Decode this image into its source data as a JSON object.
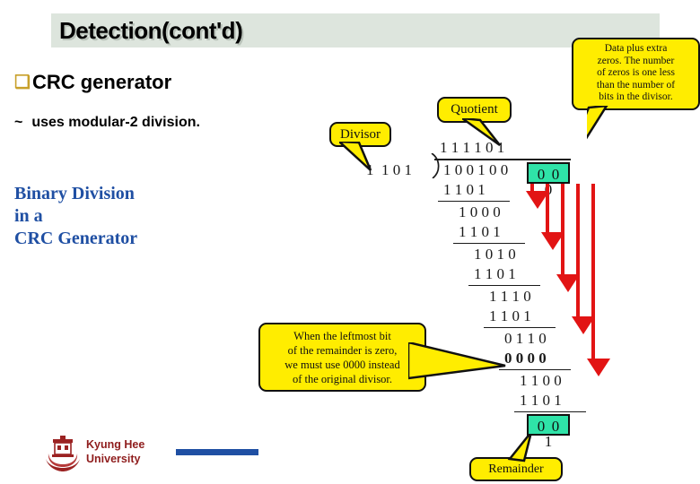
{
  "slide": {
    "title": "Detection(cont'd)",
    "bullets": [
      {
        "marker": "❑",
        "text": "CRC generator"
      },
      {
        "marker": "~",
        "text": "uses modular-2 division."
      }
    ],
    "blue_heading": "Binary Division\nin a\nCRC Generator"
  },
  "footer": {
    "logo_icon": "university-crest-icon",
    "organization": "Kyung Hee\nUniversity"
  },
  "callouts": [
    {
      "id": "divisor",
      "text": "Divisor"
    },
    {
      "id": "quotient",
      "text": "Quotient"
    },
    {
      "id": "data",
      "text": "Data plus extra\nzeros.  The number\nof zeros is one less\nthan the number of\nbits in the divisor."
    },
    {
      "id": "leftmost",
      "text": "When the leftmost bit\nof the remainder is zero,\nwe must use 0000 instead\nof the original divisor."
    },
    {
      "id": "remainder",
      "text": "Remainder"
    }
  ],
  "division": {
    "quotient": "1 1 1 1 0 1",
    "divisor": "1  1 0 1",
    "dividend": "1 0 0 1 0 0",
    "appended_zeros": "0 0 0",
    "remainder_bits": "0 0 1",
    "steps": [
      {
        "minuend": "1 0 0 1 0 0",
        "subtrahend": "1 1 0 1",
        "result": "1 0 0 0"
      },
      {
        "minuend": "1 0 0 0",
        "subtrahend": "1 1 0 1",
        "result": "1 0 1 0"
      },
      {
        "minuend": "1 0 1 0",
        "subtrahend": "1 1 0 1",
        "result": "1 1 1 0"
      },
      {
        "minuend": "1 1 1 0",
        "subtrahend": "1 1 0 1",
        "result": "0 1 1 0"
      },
      {
        "minuend": "0 1 1 0",
        "subtrahend": "0 0 0 0",
        "result": "1 1 0 0"
      },
      {
        "minuend": "1 1 0 0",
        "subtrahend": "1 1 0 1",
        "result": "0 0 1"
      }
    ],
    "rows": [
      "1 1 0 1",
      "1 0 0 0",
      "1 1 0 1",
      "1 0 1 0",
      "1 1 0 1",
      "1 1 1 0",
      "1 1 0 1",
      "0 1 1 0",
      "0 0 0 0",
      "1 1 0 0",
      "1 1 0 1"
    ]
  },
  "colors": {
    "title_band": "#dde5dd",
    "callout_fill": "#ffed00",
    "highlight_fill": "#2fe3a8",
    "arrow": "#e21414",
    "heading_blue": "#1f4fa3",
    "footer_red": "#8f1d1d",
    "bullet_gold": "#c8a02a"
  }
}
